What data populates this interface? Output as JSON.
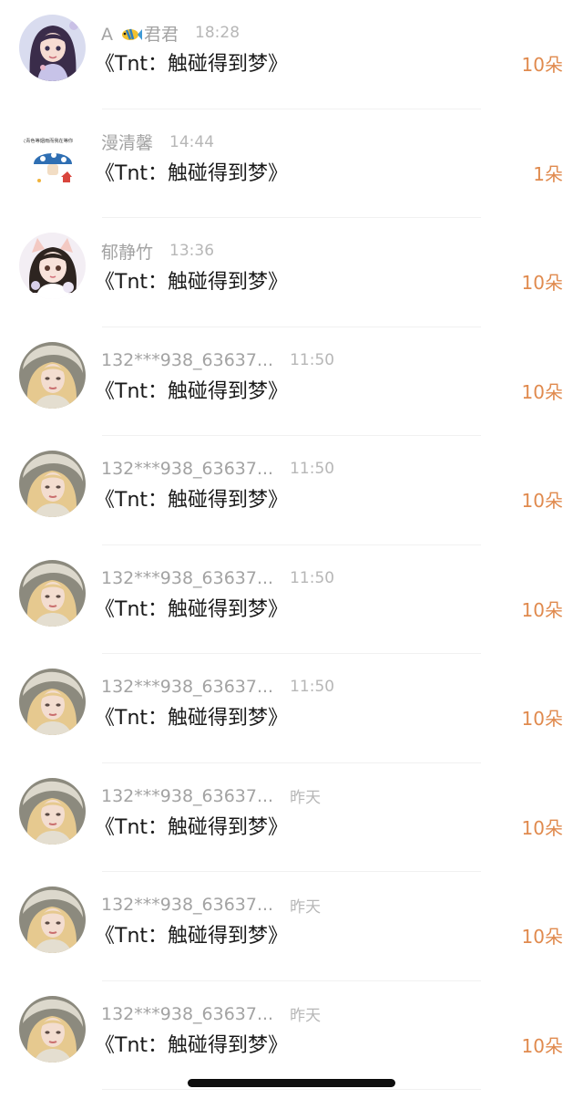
{
  "records": [
    {
      "name_prefix": "A",
      "name_suffix": "君君",
      "name_icon": "fish-icon",
      "time": "18:28",
      "gift": "《Tnt：触碰得到梦》",
      "count": "10朵",
      "avatar": "cartoon-girl-avatar"
    },
    {
      "name": "漫清馨",
      "time": "14:44",
      "gift": "《Tnt：触碰得到梦》",
      "count": "1朵",
      "avatar": "mushroom-doodle-avatar",
      "avatar_text": "天青色等烟雨而我在等你"
    },
    {
      "name": "郁静竹",
      "time": "13:36",
      "gift": "《Tnt：触碰得到梦》",
      "count": "10朵",
      "avatar": "cat-ear-girl-avatar"
    },
    {
      "name": "132***938_63637...",
      "time": "11:50",
      "gift": "《Tnt：触碰得到梦》",
      "count": "10朵",
      "avatar": "blonde-portrait-avatar"
    },
    {
      "name": "132***938_63637...",
      "time": "11:50",
      "gift": "《Tnt：触碰得到梦》",
      "count": "10朵",
      "avatar": "blonde-portrait-avatar"
    },
    {
      "name": "132***938_63637...",
      "time": "11:50",
      "gift": "《Tnt：触碰得到梦》",
      "count": "10朵",
      "avatar": "blonde-portrait-avatar"
    },
    {
      "name": "132***938_63637...",
      "time": "11:50",
      "gift": "《Tnt：触碰得到梦》",
      "count": "10朵",
      "avatar": "blonde-portrait-avatar"
    },
    {
      "name": "132***938_63637...",
      "time": "昨天",
      "gift": "《Tnt：触碰得到梦》",
      "count": "10朵",
      "avatar": "blonde-portrait-avatar"
    },
    {
      "name": "132***938_63637...",
      "time": "昨天",
      "gift": "《Tnt：触碰得到梦》",
      "count": "10朵",
      "avatar": "blonde-portrait-avatar"
    },
    {
      "name": "132***938_63637...",
      "time": "昨天",
      "gift": "《Tnt：触碰得到梦》",
      "count": "10朵",
      "avatar": "blonde-portrait-avatar"
    }
  ],
  "colors": {
    "name": "#a3a3a3",
    "time": "#b7b7b7",
    "gift": "#1a1a1a",
    "count": "#e08a4e",
    "divider": "#f1f1f1"
  }
}
